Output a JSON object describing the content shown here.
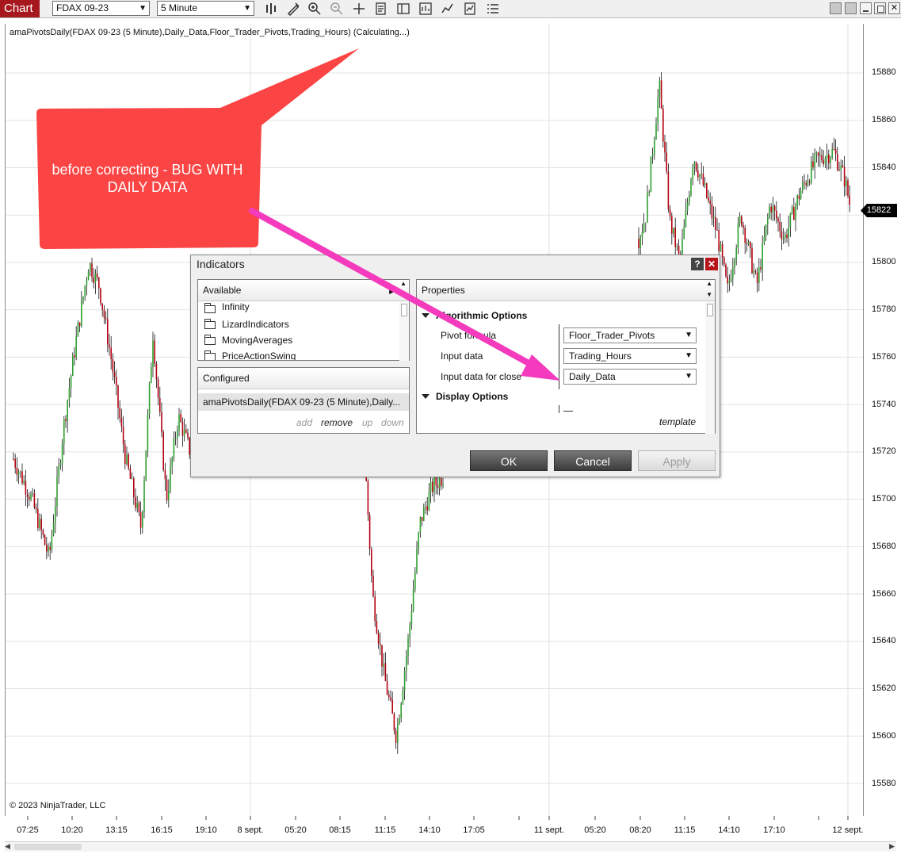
{
  "toolbar": {
    "tab_label": "Chart",
    "instrument": "FDAX 09-23",
    "interval": "5 Minute",
    "icons": [
      "bar-type-icon",
      "draw-tool-icon",
      "zoom-in-icon",
      "zoom-out-icon",
      "crosshair-icon",
      "data-box-icon",
      "templates-icon",
      "strategies-icon",
      "indicators-icon",
      "properties-icon",
      "more-icon"
    ]
  },
  "chart": {
    "indicator_label": "amaPivotsDaily(FDAX 09-23 (5 Minute),Daily_Data,Floor_Trader_Pivots,Trading_Hours) (Calculating...)",
    "copyright": "© 2023 NinjaTrader, LLC",
    "current_price": "15822",
    "price_ticks": [
      "15880",
      "15860",
      "15840",
      "15800",
      "15780",
      "15760",
      "15740",
      "15720",
      "15700",
      "15680",
      "15660",
      "15640",
      "15620",
      "15600",
      "15580"
    ],
    "time_ticks": [
      "07:25",
      "10:20",
      "13:15",
      "16:15",
      "19:10",
      "8 sept.",
      "05:20",
      "08:15",
      "11:15",
      "14:10",
      "17:05",
      "11 sept.",
      "05:20",
      "08:20",
      "11:15",
      "14:10",
      "17:10",
      "12 sept."
    ],
    "colors": {
      "up_candle": "#2f9e2f",
      "down_candle": "#b3000f",
      "wick": "#111111",
      "grid": "#e3e3e3"
    }
  },
  "callout": {
    "text": "before correcting - BUG WITH DAILY DATA",
    "color": "#fb4444"
  },
  "arrow_color": "#f43bbd",
  "dialog": {
    "title": "Indicators",
    "help_label": "?",
    "close_label": "✕",
    "available": {
      "header": "Available",
      "items": [
        "Infinity",
        "LizardIndicators",
        "MovingAverages",
        "PriceActionSwing"
      ]
    },
    "configured": {
      "header": "Configured",
      "item": "amaPivotsDaily(FDAX 09-23 (5 Minute),Daily...",
      "actions": {
        "add": "add",
        "remove": "remove",
        "up": "up",
        "down": "down"
      }
    },
    "properties": {
      "header": "Properties",
      "section1": "Algorithmic Options",
      "rows": [
        {
          "label": "Pivot formula",
          "value": "Floor_Trader_Pivots"
        },
        {
          "label": "Input data",
          "value": "Trading_Hours"
        },
        {
          "label": "Input data for close",
          "value": "Daily_Data"
        }
      ],
      "section2": "Display Options",
      "template_link": "template"
    },
    "buttons": {
      "ok": "OK",
      "cancel": "Cancel",
      "apply": "Apply"
    }
  }
}
